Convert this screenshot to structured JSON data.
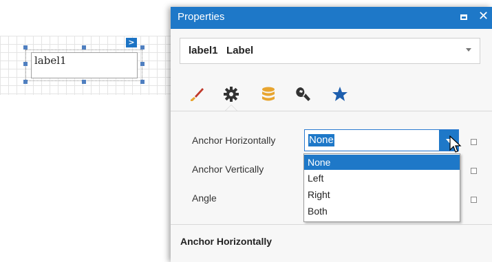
{
  "designer": {
    "label_text": "label1",
    "smart_tag_glyph": ">"
  },
  "properties": {
    "title": "Properties",
    "maximize_icon": "maximize-icon",
    "close_glyph": "✕",
    "object_selector": {
      "name": "label1",
      "type": "Label"
    },
    "tabs": [
      {
        "icon": "paintbrush-icon",
        "color": "#c0392b"
      },
      {
        "icon": "gear-icon",
        "color": "#333333",
        "selected": true
      },
      {
        "icon": "database-icon",
        "color": "#e8a530"
      },
      {
        "icon": "wrench-icon",
        "color": "#333333"
      },
      {
        "icon": "star-icon",
        "color": "#1e5fae"
      }
    ],
    "rows": [
      {
        "label": "Anchor Horizontally"
      },
      {
        "label": "Anchor Vertically"
      },
      {
        "label": "Angle"
      }
    ],
    "editor_value": "None",
    "dropdown_options": [
      "None",
      "Left",
      "Right",
      "Both"
    ],
    "selected_option": "None",
    "description_title": "Anchor Horizontally"
  },
  "colors": {
    "accent": "#1e78c8"
  }
}
